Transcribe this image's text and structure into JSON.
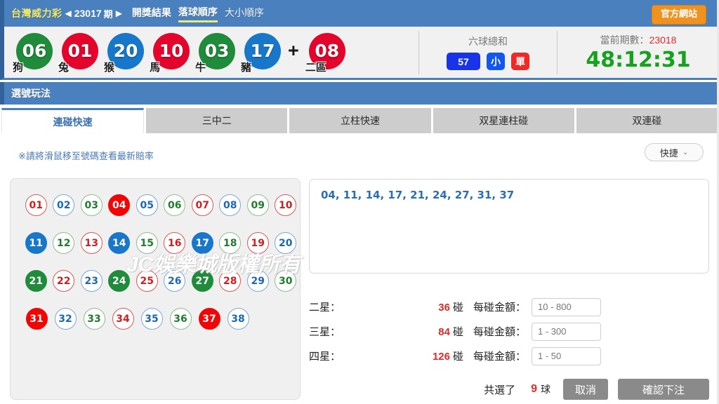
{
  "header": {
    "brand": "台灣威力彩",
    "prev_arrow": "◀",
    "next_arrow": "▶",
    "period_number": "23017",
    "period_unit": "期",
    "nav": [
      {
        "label": "開獎結果",
        "active": false
      },
      {
        "label": "落球順序",
        "active": true
      },
      {
        "label": "大小順序",
        "active": false
      }
    ],
    "official_site": "官方網站"
  },
  "draw": {
    "balls": [
      {
        "num": "06",
        "color": "green",
        "zodiac": "狗"
      },
      {
        "num": "01",
        "color": "red",
        "zodiac": "兔"
      },
      {
        "num": "20",
        "color": "blue",
        "zodiac": "猴"
      },
      {
        "num": "10",
        "color": "red",
        "zodiac": "馬"
      },
      {
        "num": "03",
        "color": "green",
        "zodiac": "牛"
      },
      {
        "num": "17",
        "color": "blue",
        "zodiac": "豬"
      }
    ],
    "plus": "+",
    "special": {
      "num": "08",
      "color": "red",
      "zodiac": "二區"
    },
    "sum_label": "六球總和",
    "sum_value": "57",
    "sum_size": "小",
    "sum_parity": "單",
    "current_period_label": "當前期數：",
    "current_period_value": "23018",
    "countdown": "48:12:31"
  },
  "section": {
    "title": "選號玩法"
  },
  "tabs": [
    {
      "label": "連碰快速",
      "active": true
    },
    {
      "label": "三中二",
      "active": false
    },
    {
      "label": "立柱快速",
      "active": false
    },
    {
      "label": "双星連柱碰",
      "active": false
    },
    {
      "label": "双連碰",
      "active": false
    }
  ],
  "toolbar": {
    "hint": "※請將滑鼠移至號碼查看最新賠率",
    "quick_label": "快捷",
    "quick_caret": "⌄"
  },
  "number_grid": {
    "rows": [
      [
        {
          "n": "01",
          "style": "o-red"
        },
        {
          "n": "02",
          "style": "o-blue"
        },
        {
          "n": "03",
          "style": "o-green"
        },
        {
          "n": "04",
          "style": "f-red"
        },
        {
          "n": "05",
          "style": "o-blue"
        },
        {
          "n": "06",
          "style": "o-green"
        },
        {
          "n": "07",
          "style": "o-red"
        },
        {
          "n": "08",
          "style": "o-blue"
        },
        {
          "n": "09",
          "style": "o-green"
        },
        {
          "n": "10",
          "style": "o-red"
        }
      ],
      [
        {
          "n": "11",
          "style": "f-blue"
        },
        {
          "n": "12",
          "style": "o-green"
        },
        {
          "n": "13",
          "style": "o-red"
        },
        {
          "n": "14",
          "style": "f-blue"
        },
        {
          "n": "15",
          "style": "o-green"
        },
        {
          "n": "16",
          "style": "o-red"
        },
        {
          "n": "17",
          "style": "f-blue"
        },
        {
          "n": "18",
          "style": "o-green"
        },
        {
          "n": "19",
          "style": "o-red"
        },
        {
          "n": "20",
          "style": "o-blue"
        }
      ],
      [
        {
          "n": "21",
          "style": "f-green"
        },
        {
          "n": "22",
          "style": "o-red"
        },
        {
          "n": "23",
          "style": "o-blue"
        },
        {
          "n": "24",
          "style": "f-green"
        },
        {
          "n": "25",
          "style": "o-red"
        },
        {
          "n": "26",
          "style": "o-blue"
        },
        {
          "n": "27",
          "style": "f-green"
        },
        {
          "n": "28",
          "style": "o-red"
        },
        {
          "n": "29",
          "style": "o-blue"
        },
        {
          "n": "30",
          "style": "o-green"
        }
      ],
      [
        {
          "n": "31",
          "style": "f-red"
        },
        {
          "n": "32",
          "style": "o-blue"
        },
        {
          "n": "33",
          "style": "o-green"
        },
        {
          "n": "34",
          "style": "o-red"
        },
        {
          "n": "35",
          "style": "o-blue"
        },
        {
          "n": "36",
          "style": "o-green"
        },
        {
          "n": "37",
          "style": "f-red"
        },
        {
          "n": "38",
          "style": "o-blue"
        }
      ]
    ]
  },
  "selection": {
    "numbers_text": "04, 11, 14, 17, 21, 24, 27, 31, 37",
    "watermark": "JC娛樂城版權所有"
  },
  "bets": [
    {
      "label": "二星：",
      "count": "36",
      "unit": "碰",
      "amount_label": "每碰金額：",
      "placeholder": "10 - 800"
    },
    {
      "label": "三星：",
      "count": "84",
      "unit": "碰",
      "amount_label": "每碰金額：",
      "placeholder": "1 - 300"
    },
    {
      "label": "四星：",
      "count": "126",
      "unit": "碰",
      "amount_label": "每碰金額：",
      "placeholder": "1 - 50"
    }
  ],
  "footer": {
    "total_label": "共選了",
    "total_count": "9",
    "total_unit": "球",
    "cancel": "取消",
    "confirm": "確認下注"
  },
  "colors": {
    "header_blue": "#4a80bd",
    "accent_yellow": "#f2e96a",
    "orange": "#f0921f",
    "ball_red": "#e4052c",
    "ball_green": "#1f8b3b",
    "ball_blue": "#1877c9",
    "countdown_green": "#16a11e",
    "alert_red": "#e02b2b"
  }
}
